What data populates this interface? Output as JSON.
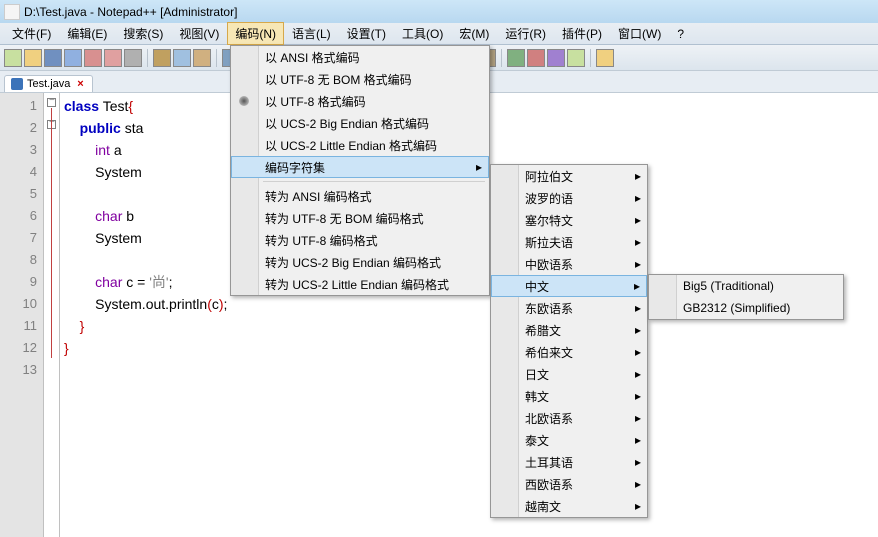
{
  "window": {
    "title": "D:\\Test.java - Notepad++ [Administrator]"
  },
  "menubar": [
    {
      "label": "文件(F)"
    },
    {
      "label": "编辑(E)"
    },
    {
      "label": "搜索(S)"
    },
    {
      "label": "视图(V)"
    },
    {
      "label": "编码(N)",
      "active": true
    },
    {
      "label": "语言(L)"
    },
    {
      "label": "设置(T)"
    },
    {
      "label": "工具(O)"
    },
    {
      "label": "宏(M)"
    },
    {
      "label": "运行(R)"
    },
    {
      "label": "插件(P)"
    },
    {
      "label": "窗口(W)"
    },
    {
      "label": "?"
    }
  ],
  "toolbar_icons": [
    "new-file",
    "open-file",
    "save-file",
    "save-all",
    "close-file",
    "close-all",
    "print",
    "sep",
    "cut",
    "copy",
    "paste",
    "sep",
    "undo",
    "redo",
    "sep",
    "find",
    "replace",
    "sep",
    "zoom-in",
    "zoom-out",
    "sep",
    "wrap",
    "show-all",
    "indent-guide",
    "sep",
    "doc-map",
    "func-list",
    "folder",
    "sep",
    "macro-record",
    "macro-play",
    "macro-replay",
    "macro-save",
    "sep",
    "bold-h"
  ],
  "tab": {
    "name": "Test.java"
  },
  "code_lines": [
    {
      "n": 1,
      "html": "<span class='kw'>class</span> <span class='id'>Test</span><span class='br'>{</span>"
    },
    {
      "n": 2,
      "html": "    <span class='kw'>public</span> <span class='id'>sta</span>                         <span class='br'>{</span>"
    },
    {
      "n": 3,
      "html": "        <span class='ty'>int</span> <span class='id'>a</span> "
    },
    {
      "n": 4,
      "html": "        <span class='id'>System</span>"
    },
    {
      "n": 5,
      "html": ""
    },
    {
      "n": 6,
      "html": "        <span class='ty'>char</span> <span class='id'>b</span>"
    },
    {
      "n": 7,
      "html": "        <span class='id'>System</span>"
    },
    {
      "n": 8,
      "html": ""
    },
    {
      "n": 9,
      "html": "        <span class='ty'>char</span> <span class='id'>c</span> <span class='pun'>=</span> <span class='str'>'尚'</span><span class='pun'>;</span>"
    },
    {
      "n": 10,
      "html": "        <span class='id'>System.out.println</span><span class='br'>(</span><span class='id'>c</span><span class='br'>)</span><span class='pun'>;</span>"
    },
    {
      "n": 11,
      "html": "    <span class='br'>}</span>"
    },
    {
      "n": 12,
      "html": "<span class='br'>}</span>"
    },
    {
      "n": 13,
      "html": ""
    }
  ],
  "menu_encoding": {
    "g1": [
      {
        "label": "以 ANSI 格式编码"
      },
      {
        "label": "以 UTF-8 无 BOM 格式编码"
      },
      {
        "label": "以 UTF-8 格式编码",
        "bullet": true
      },
      {
        "label": "以 UCS-2 Big Endian 格式编码"
      },
      {
        "label": "以 UCS-2 Little Endian 格式编码"
      },
      {
        "label": "编码字符集",
        "sub": true,
        "highlight": true
      }
    ],
    "g2": [
      {
        "label": "转为 ANSI 编码格式"
      },
      {
        "label": "转为 UTF-8 无 BOM 编码格式"
      },
      {
        "label": "转为 UTF-8 编码格式"
      },
      {
        "label": "转为 UCS-2 Big Endian 编码格式"
      },
      {
        "label": "转为 UCS-2 Little Endian 编码格式"
      }
    ]
  },
  "menu_charset": [
    {
      "label": "阿拉伯文",
      "sub": true
    },
    {
      "label": "波罗的语",
      "sub": true
    },
    {
      "label": "塞尔特文",
      "sub": true
    },
    {
      "label": "斯拉夫语",
      "sub": true
    },
    {
      "label": "中欧语系",
      "sub": true
    },
    {
      "label": "中文",
      "sub": true,
      "highlight": true
    },
    {
      "label": "东欧语系",
      "sub": true
    },
    {
      "label": "希腊文",
      "sub": true
    },
    {
      "label": "希伯来文",
      "sub": true
    },
    {
      "label": "日文",
      "sub": true
    },
    {
      "label": "韩文",
      "sub": true
    },
    {
      "label": "北欧语系",
      "sub": true
    },
    {
      "label": "泰文",
      "sub": true
    },
    {
      "label": "土耳其语",
      "sub": true
    },
    {
      "label": "西欧语系",
      "sub": true
    },
    {
      "label": "越南文",
      "sub": true
    }
  ],
  "menu_chinese": [
    {
      "label": "Big5 (Traditional)"
    },
    {
      "label": "GB2312 (Simplified)"
    }
  ]
}
